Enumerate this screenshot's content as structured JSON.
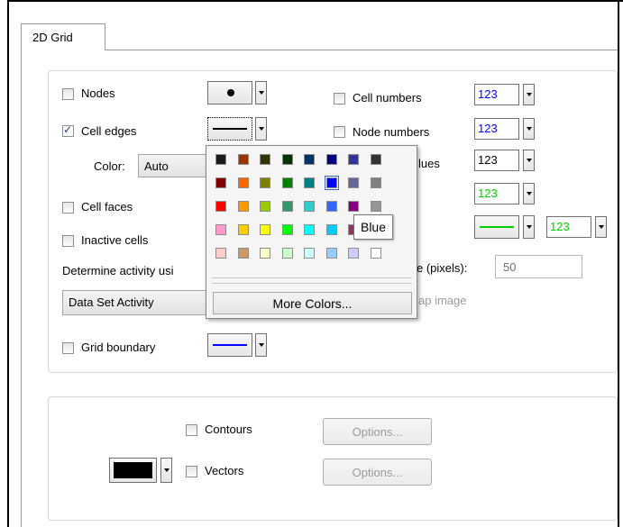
{
  "tab": {
    "label": "2D Grid"
  },
  "options": {
    "nodes": {
      "label": "Nodes",
      "checked": false
    },
    "cell_edges": {
      "label": "Cell edges",
      "checked": true
    },
    "color": {
      "label": "Color:",
      "value": "Auto"
    },
    "cell_faces": {
      "label": "Cell faces",
      "checked": false
    },
    "inactive_cells": {
      "label": "Inactive cells",
      "checked": false
    },
    "determine_activity": {
      "label": "Determine activity usi"
    },
    "activity_source": {
      "value": "Data Set Activity"
    },
    "grid_boundary": {
      "label": "Grid boundary",
      "checked": false
    },
    "cell_numbers": {
      "label": "Cell numbers",
      "checked": false,
      "sample": "123"
    },
    "node_numbers": {
      "label": "Node numbers",
      "checked": false,
      "sample": "123"
    },
    "values_label": {
      "label": "lues",
      "sample": "123"
    },
    "green_sample": {
      "sample": "123"
    },
    "line_sample": {
      "sample": "123"
    },
    "size_label": {
      "label": "e (pixels):",
      "value": "50"
    },
    "map_image_label": {
      "label": "ap image"
    }
  },
  "lower": {
    "contours": {
      "label": "Contours",
      "button": "Options..."
    },
    "vectors": {
      "label": "Vectors",
      "button": "Options..."
    }
  },
  "color_picker": {
    "rows": [
      [
        "#1a1a1a",
        "#993300",
        "#333300",
        "#003300",
        "#003366",
        "#000080",
        "#333399",
        "#333333"
      ],
      [
        "#800000",
        "#ff6600",
        "#808000",
        "#008000",
        "#008080",
        "#0000ff",
        "#666699",
        "#808080"
      ],
      [
        "#ff0000",
        "#ff9900",
        "#99cc00",
        "#339966",
        "#33cccc",
        "#3366ff",
        "#800080",
        "#969696"
      ],
      [
        "#ff99cc",
        "#ffcc00",
        "#ffff00",
        "#00ff00",
        "#00ffff",
        "#00ccff",
        "#993366",
        "#c0c0c0"
      ],
      [
        "#ffcccc",
        "#cc9966",
        "#ffffcc",
        "#ccffcc",
        "#ccffff",
        "#99ccff",
        "#ccccff",
        "#ffffff"
      ]
    ],
    "selected": "Blue",
    "more_colors": "More Colors...",
    "tooltip": "Blue"
  },
  "colors": {
    "blue_number": "#0000ff",
    "green_number": "#00d000",
    "grid_boundary_line": "#0000ff",
    "vectors_swatch": "#000000"
  }
}
